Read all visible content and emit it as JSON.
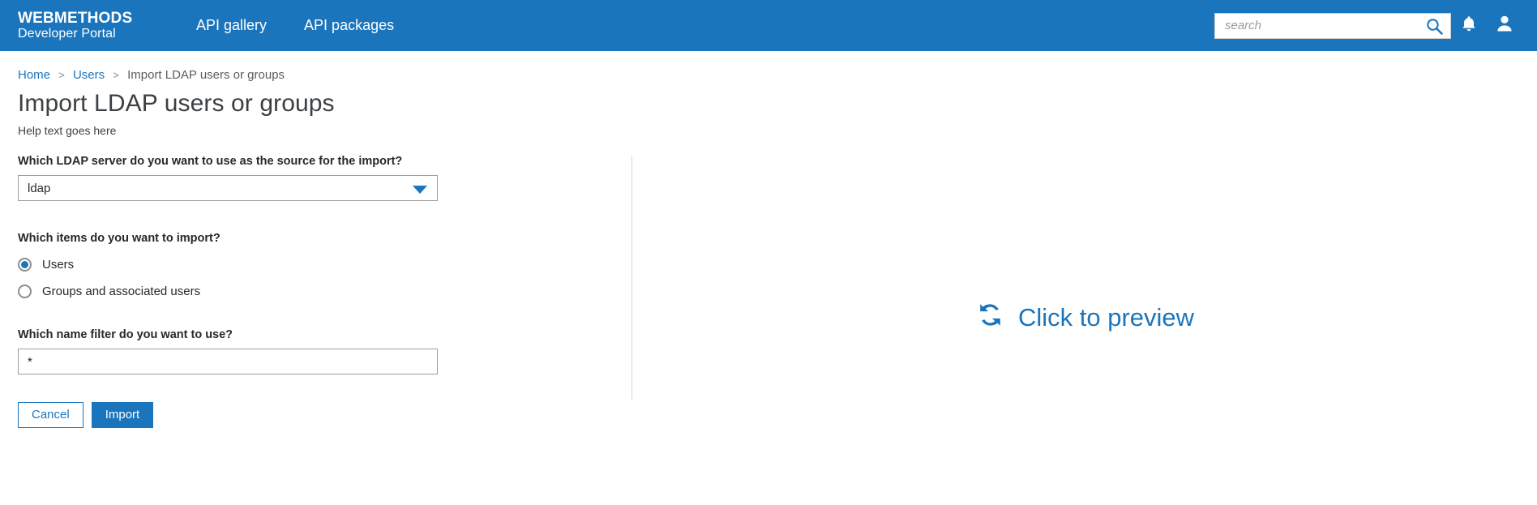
{
  "header": {
    "brand_top": "WEBMETHODS",
    "brand_bottom": "Developer Portal",
    "nav": [
      {
        "label": "API gallery"
      },
      {
        "label": "API packages"
      }
    ],
    "search": {
      "placeholder": "search",
      "value": "",
      "icon": "search-icon"
    },
    "notifications_icon": "bell-icon",
    "account_icon": "user-avatar-icon",
    "background_color": "#1b75bc"
  },
  "breadcrumb": {
    "items": [
      {
        "label": "Home",
        "link": true
      },
      {
        "label": "Users",
        "link": true
      },
      {
        "label": "Import LDAP users or groups",
        "link": false
      }
    ],
    "separator": ">"
  },
  "page": {
    "title": "Import LDAP users or groups",
    "help_text": "Help text goes here"
  },
  "form": {
    "server": {
      "label": "Which LDAP server do you want to use as the source for the import?",
      "selected": "ldap",
      "arrow_icon": "chevron-down-icon"
    },
    "items": {
      "label": "Which items do you want to import?",
      "options": [
        {
          "label": "Users",
          "checked": true
        },
        {
          "label": "Groups and associated users",
          "checked": false
        }
      ]
    },
    "name_filter": {
      "label": "Which name filter do you want to use?",
      "value": "*",
      "placeholder": ""
    },
    "buttons": {
      "cancel": "Cancel",
      "import": "Import"
    }
  },
  "preview": {
    "label": "Click to preview",
    "icon": "refresh-sync-icon",
    "color": "#1b75bc"
  }
}
